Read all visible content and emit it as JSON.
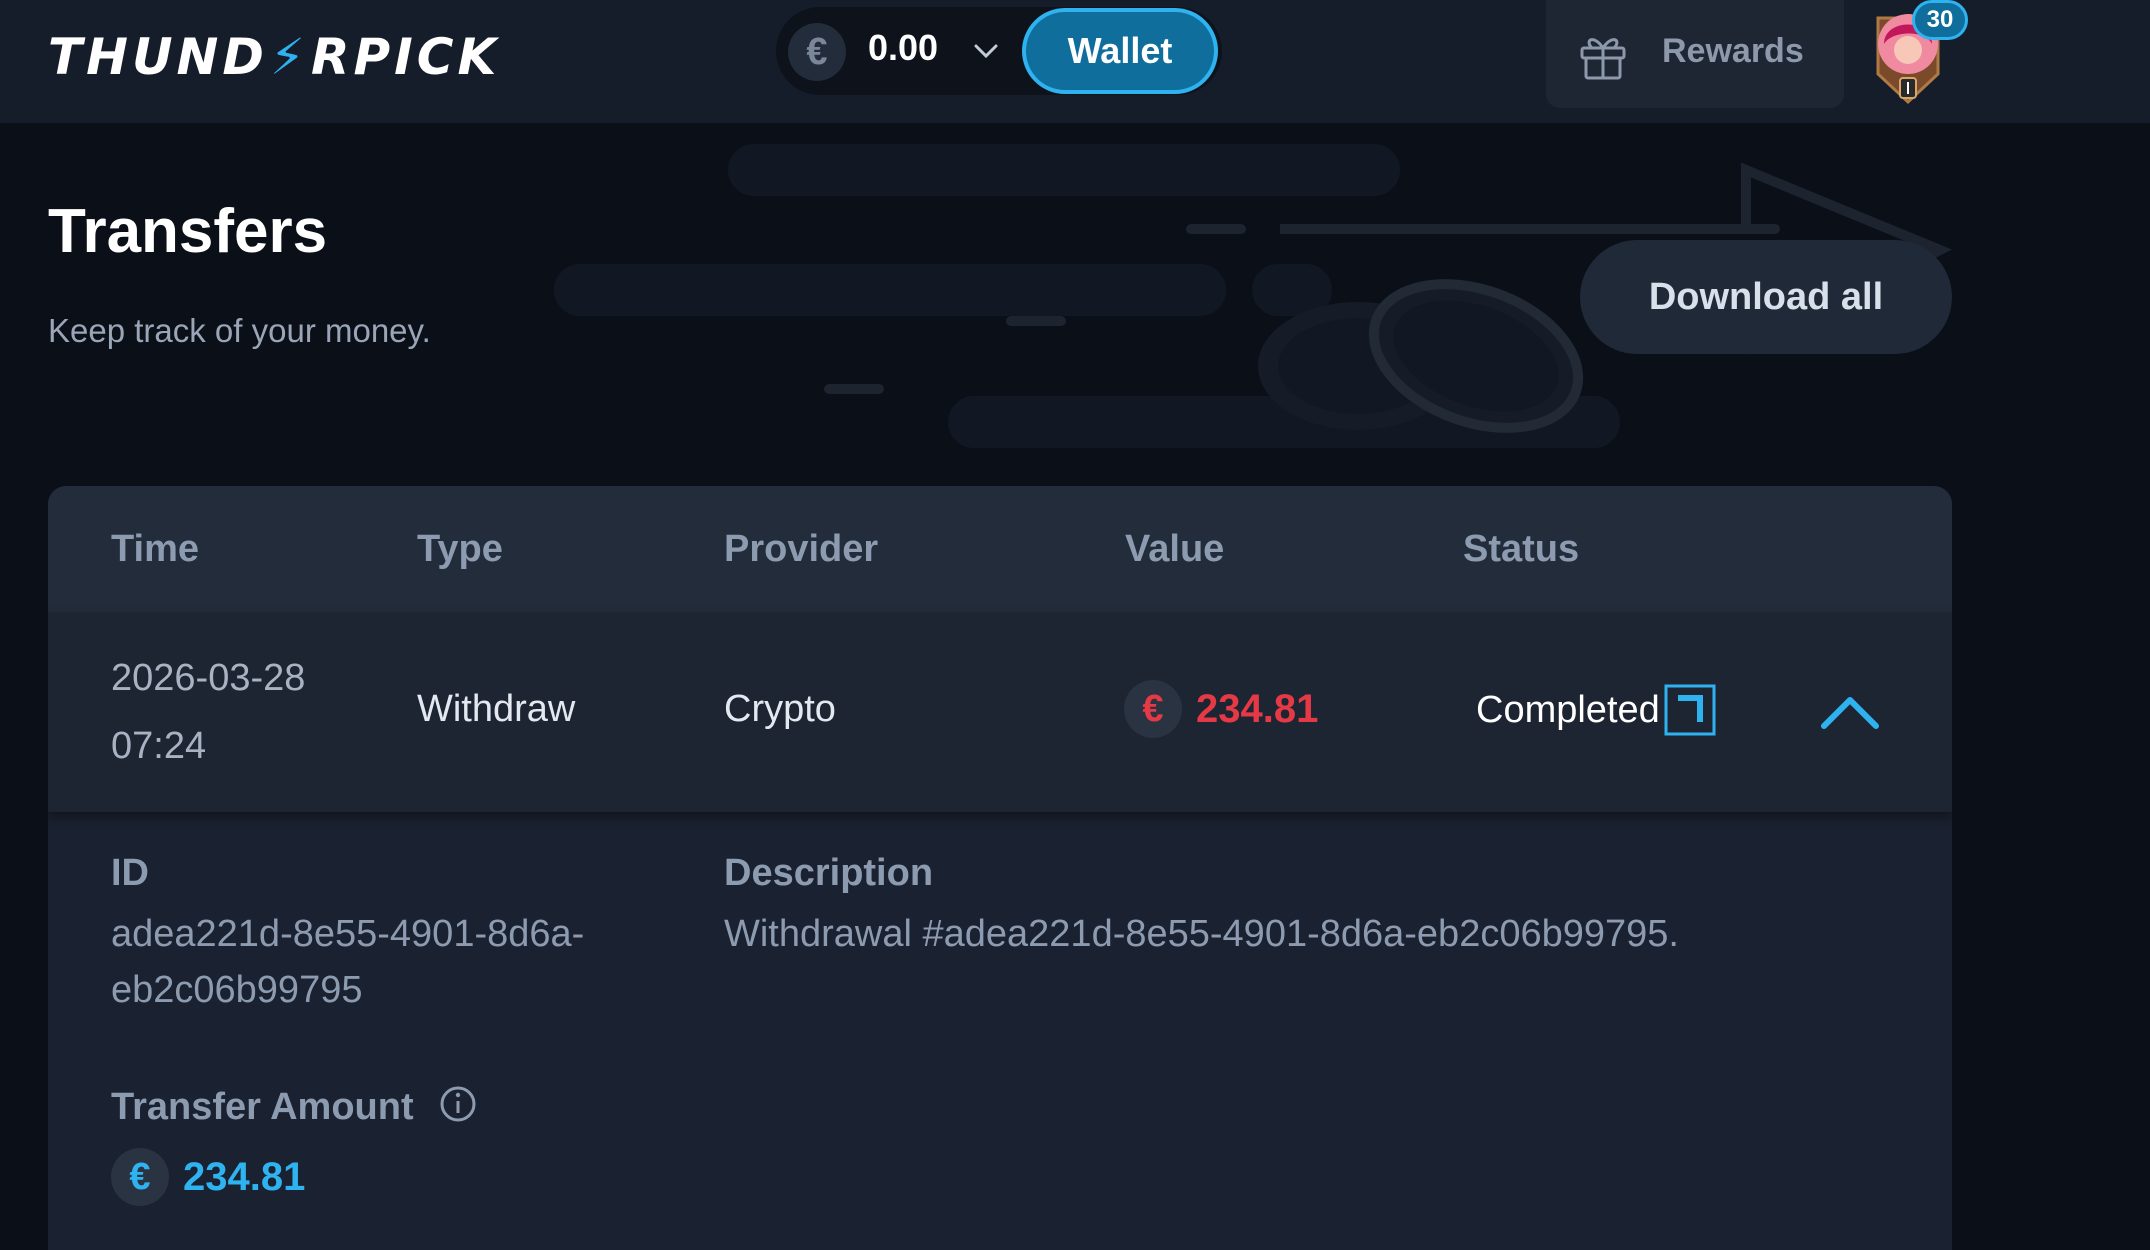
{
  "header": {
    "logo": {
      "left": "THUND",
      "bolt": "⚡",
      "right": "RPICK"
    },
    "balance": {
      "currency_symbol": "€",
      "amount": "0.00"
    },
    "wallet_label": "Wallet",
    "rewards_label": "Rewards",
    "level": "30"
  },
  "page": {
    "title": "Transfers",
    "subtitle": "Keep track of your money.",
    "download_label": "Download all"
  },
  "table": {
    "columns": [
      "Time",
      "Type",
      "Provider",
      "Value",
      "Status"
    ],
    "rows": [
      {
        "date": "2026-03-28",
        "time": "07:24",
        "type": "Withdraw",
        "provider": "Crypto",
        "currency_symbol": "€",
        "value": "234.81",
        "status": "Completed"
      }
    ],
    "details": {
      "id_label": "ID",
      "id_line1": "adea221d-8e55-4901-8d6a-",
      "id_line2": "eb2c06b99795",
      "description_label": "Description",
      "description": "Withdrawal #adea221d-8e55-4901-8d6a-eb2c06b99795.",
      "amount_label": "Transfer Amount",
      "currency_symbol": "€",
      "amount": "234.81"
    }
  },
  "colors": {
    "background": "#0b0f17",
    "accent": "#2fb3f0",
    "negative": "#e63946",
    "muted": "#8d9bb0"
  }
}
